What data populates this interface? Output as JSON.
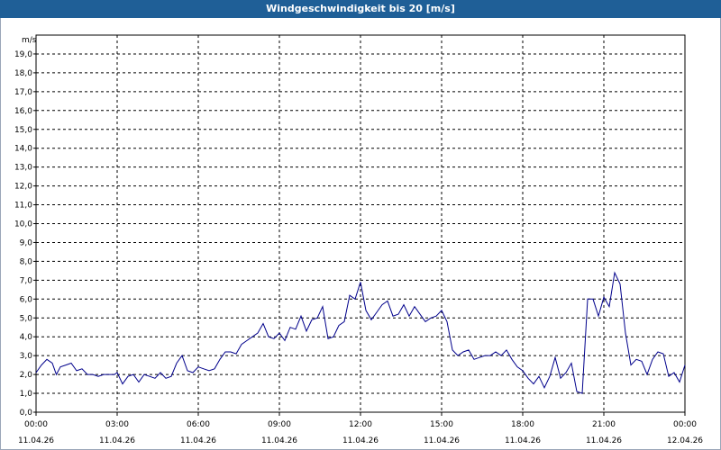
{
  "window": {
    "title": "Windgeschwindigkeit bis 20 [m/s]"
  },
  "colors": {
    "titlebar": "#1f5f97",
    "series": "#00008b",
    "grid": "#000000"
  },
  "chart_data": {
    "type": "line",
    "title": "Windgeschwindigkeit bis 20 [m/s]",
    "ylabel": "m/s",
    "xlabel": "",
    "ylim": [
      0,
      20
    ],
    "xlim_hours": [
      0,
      24
    ],
    "grid": true,
    "y_ticks": [
      "0,0",
      "1,0",
      "2,0",
      "3,0",
      "4,0",
      "5,0",
      "6,0",
      "7,0",
      "8,0",
      "9,0",
      "10,0",
      "11,0",
      "12,0",
      "13,0",
      "14,0",
      "15,0",
      "16,0",
      "17,0",
      "18,0",
      "19,0"
    ],
    "x_ticks": [
      {
        "time": "00:00",
        "date": "11.04.26"
      },
      {
        "time": "03:00",
        "date": "11.04.26"
      },
      {
        "time": "06:00",
        "date": "11.04.26"
      },
      {
        "time": "09:00",
        "date": "11.04.26"
      },
      {
        "time": "12:00",
        "date": "11.04.26"
      },
      {
        "time": "15:00",
        "date": "11.04.26"
      },
      {
        "time": "18:00",
        "date": "11.04.26"
      },
      {
        "time": "21:00",
        "date": "11.04.26"
      },
      {
        "time": "00:00",
        "date": "12.04.26"
      }
    ],
    "series": [
      {
        "x_hours": [
          0,
          0.2,
          0.4,
          0.6,
          0.75,
          0.9,
          1.1,
          1.3,
          1.5,
          1.7,
          1.9,
          2.1,
          2.3,
          2.5,
          2.7,
          2.9,
          3.0,
          3.2,
          3.4,
          3.6,
          3.8,
          4.0,
          4.2,
          4.4,
          4.6,
          4.8,
          5.0,
          5.2,
          5.4,
          5.6,
          5.8,
          6.0,
          6.2,
          6.4,
          6.6,
          6.8,
          7.0,
          7.2,
          7.4,
          7.6,
          7.8,
          8.0,
          8.2,
          8.4,
          8.6,
          8.8,
          9.0,
          9.2,
          9.4,
          9.6,
          9.8,
          10.0,
          10.2,
          10.4,
          10.6,
          10.8,
          11.0,
          11.2,
          11.4,
          11.6,
          11.8,
          12.0,
          12.2,
          12.4,
          12.6,
          12.8,
          13.0,
          13.2,
          13.4,
          13.6,
          13.8,
          14.0,
          14.2,
          14.4,
          14.6,
          14.8,
          15.0,
          15.2,
          15.4,
          15.6,
          15.8,
          16.0,
          16.2,
          16.4,
          16.6,
          16.8,
          17.0,
          17.2,
          17.4,
          17.6,
          17.8,
          18.0,
          18.2,
          18.4,
          18.6,
          18.8,
          19.0,
          19.2,
          19.4,
          19.6,
          19.8,
          20.0,
          20.2,
          20.4,
          20.6,
          20.8,
          21.0,
          21.2,
          21.4,
          21.6,
          21.8,
          22.0,
          22.2,
          22.4,
          22.6,
          22.8,
          23.0,
          23.2,
          23.4,
          23.6,
          23.8,
          24.0
        ],
        "values": [
          2.1,
          2.5,
          2.8,
          2.6,
          2.0,
          2.4,
          2.5,
          2.6,
          2.2,
          2.3,
          2.0,
          2.0,
          1.9,
          2.0,
          2.0,
          2.0,
          2.1,
          1.5,
          1.9,
          2.0,
          1.6,
          2.0,
          1.9,
          1.8,
          2.1,
          1.8,
          1.9,
          2.6,
          3.0,
          2.2,
          2.1,
          2.4,
          2.3,
          2.2,
          2.3,
          2.8,
          3.2,
          3.2,
          3.1,
          3.6,
          3.8,
          4.0,
          4.2,
          4.7,
          4.0,
          3.9,
          4.2,
          3.8,
          4.5,
          4.4,
          5.1,
          4.3,
          4.9,
          5.0,
          5.6,
          3.9,
          4.0,
          4.6,
          4.8,
          6.2,
          6.0,
          6.9,
          5.4,
          4.9,
          5.3,
          5.7,
          5.9,
          5.1,
          5.2,
          5.7,
          5.1,
          5.6,
          5.2,
          4.8,
          5.0,
          5.1,
          5.4,
          4.8,
          3.3,
          3.0,
          3.2,
          3.3,
          2.8,
          2.9,
          3.0,
          3.0,
          3.2,
          3.0,
          3.3,
          2.8,
          2.4,
          2.2,
          1.8,
          1.5,
          1.9,
          1.3,
          1.9,
          2.9,
          1.8,
          2.1,
          2.6,
          1.1,
          1.0,
          6.0,
          6.0,
          5.1,
          6.1,
          5.6,
          7.4,
          6.8,
          4.2,
          2.5,
          2.8,
          2.7,
          2.0,
          2.8,
          3.2,
          3.1,
          1.9,
          2.1,
          1.6,
          2.5
        ]
      }
    ]
  }
}
